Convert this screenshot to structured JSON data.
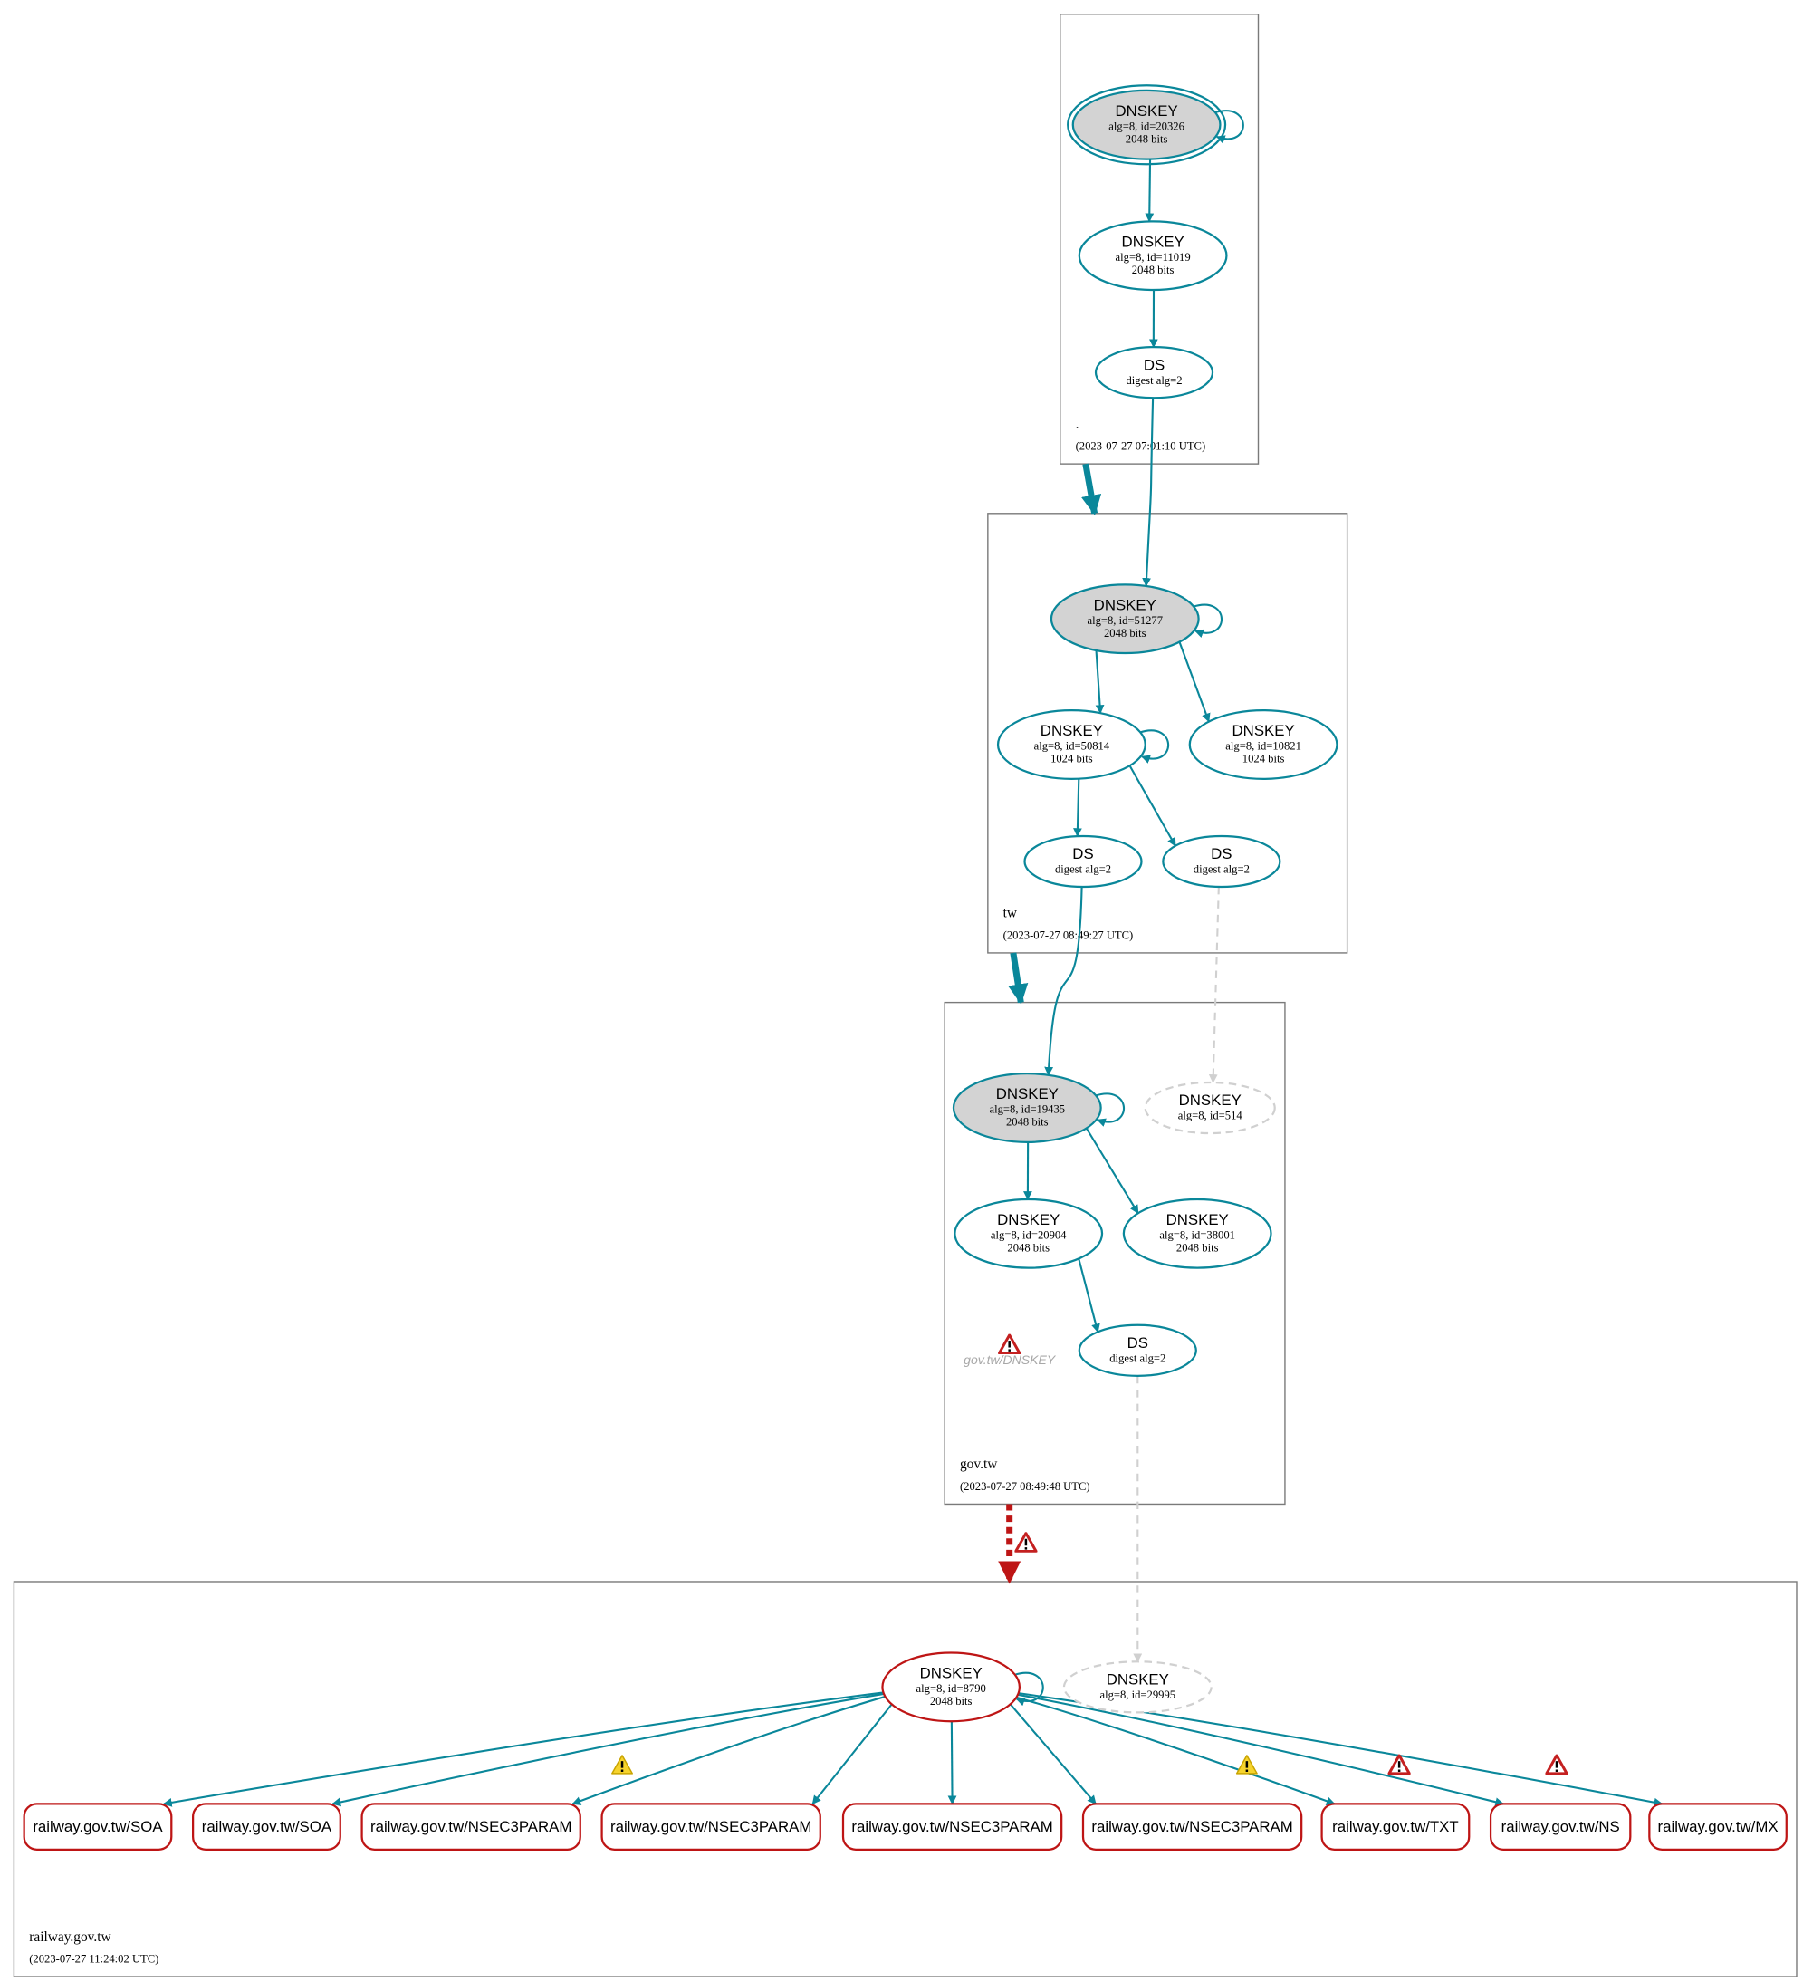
{
  "colors": {
    "secure": "#0a879a",
    "error": "#be1515",
    "dim": "#d0d0d0",
    "ksk_fill": "#d3d3d3",
    "zone_border": "#7a7a7a"
  },
  "zones": [
    {
      "id": "root",
      "name": ".",
      "timestamp": "(2023-07-27 07:01:10 UTC)"
    },
    {
      "id": "tw",
      "name": "tw",
      "timestamp": "(2023-07-27 08:49:27 UTC)"
    },
    {
      "id": "govtw",
      "name": "gov.tw",
      "timestamp": "(2023-07-27 08:49:48 UTC)"
    },
    {
      "id": "railway",
      "name": "railway.gov.tw",
      "timestamp": "(2023-07-27 11:24:02 UTC)"
    }
  ],
  "nodes": [
    {
      "id": "root_ksk",
      "zone": "root",
      "type": "DNSKEY",
      "title": "DNSKEY",
      "detail": "alg=8, id=20326",
      "bits": "2048 bits",
      "status": "secure",
      "sep": true,
      "trust_anchor": true
    },
    {
      "id": "root_zsk",
      "zone": "root",
      "type": "DNSKEY",
      "title": "DNSKEY",
      "detail": "alg=8, id=11019",
      "bits": "2048 bits",
      "status": "secure"
    },
    {
      "id": "root_ds",
      "zone": "root",
      "type": "DS",
      "title": "DS",
      "detail": "digest alg=2",
      "status": "secure"
    },
    {
      "id": "tw_ksk",
      "zone": "tw",
      "type": "DNSKEY",
      "title": "DNSKEY",
      "detail": "alg=8, id=51277",
      "bits": "2048 bits",
      "status": "secure",
      "sep": true
    },
    {
      "id": "tw_zsk1",
      "zone": "tw",
      "type": "DNSKEY",
      "title": "DNSKEY",
      "detail": "alg=8, id=50814",
      "bits": "1024 bits",
      "status": "secure"
    },
    {
      "id": "tw_zsk2",
      "zone": "tw",
      "type": "DNSKEY",
      "title": "DNSKEY",
      "detail": "alg=8, id=10821",
      "bits": "1024 bits",
      "status": "secure"
    },
    {
      "id": "tw_ds1",
      "zone": "tw",
      "type": "DS",
      "title": "DS",
      "detail": "digest alg=2",
      "status": "secure"
    },
    {
      "id": "tw_ds2",
      "zone": "tw",
      "type": "DS",
      "title": "DS",
      "detail": "digest alg=2",
      "status": "secure"
    },
    {
      "id": "gov_ksk",
      "zone": "govtw",
      "type": "DNSKEY",
      "title": "DNSKEY",
      "detail": "alg=8, id=19435",
      "bits": "2048 bits",
      "status": "secure",
      "sep": true
    },
    {
      "id": "gov_missing",
      "zone": "govtw",
      "type": "DNSKEY",
      "title": "DNSKEY",
      "detail": "alg=8, id=514",
      "status": "missing"
    },
    {
      "id": "gov_zsk1",
      "zone": "govtw",
      "type": "DNSKEY",
      "title": "DNSKEY",
      "detail": "alg=8, id=20904",
      "bits": "2048 bits",
      "status": "secure"
    },
    {
      "id": "gov_zsk2",
      "zone": "govtw",
      "type": "DNSKEY",
      "title": "DNSKEY",
      "detail": "alg=8, id=38001",
      "bits": "2048 bits",
      "status": "secure"
    },
    {
      "id": "gov_ds",
      "zone": "govtw",
      "type": "DS",
      "title": "DS",
      "detail": "digest alg=2",
      "status": "secure"
    },
    {
      "id": "rw_key",
      "zone": "railway",
      "type": "DNSKEY",
      "title": "DNSKEY",
      "detail": "alg=8, id=8790",
      "bits": "2048 bits",
      "status": "bogus"
    },
    {
      "id": "rw_missing",
      "zone": "railway",
      "type": "DNSKEY",
      "title": "DNSKEY",
      "detail": "alg=8, id=29995",
      "status": "missing"
    },
    {
      "id": "rr1",
      "zone": "railway",
      "type": "RRset",
      "title": "railway.gov.tw/SOA",
      "status": "bogus"
    },
    {
      "id": "rr2",
      "zone": "railway",
      "type": "RRset",
      "title": "railway.gov.tw/SOA",
      "status": "bogus"
    },
    {
      "id": "rr3",
      "zone": "railway",
      "type": "RRset",
      "title": "railway.gov.tw/NSEC3PARAM",
      "status": "bogus"
    },
    {
      "id": "rr4",
      "zone": "railway",
      "type": "RRset",
      "title": "railway.gov.tw/NSEC3PARAM",
      "status": "bogus"
    },
    {
      "id": "rr5",
      "zone": "railway",
      "type": "RRset",
      "title": "railway.gov.tw/NSEC3PARAM",
      "status": "bogus"
    },
    {
      "id": "rr6",
      "zone": "railway",
      "type": "RRset",
      "title": "railway.gov.tw/NSEC3PARAM",
      "status": "bogus"
    },
    {
      "id": "rr7",
      "zone": "railway",
      "type": "RRset",
      "title": "railway.gov.tw/TXT",
      "status": "bogus"
    },
    {
      "id": "rr8",
      "zone": "railway",
      "type": "RRset",
      "title": "railway.gov.tw/NS",
      "status": "bogus"
    },
    {
      "id": "rr9",
      "zone": "railway",
      "type": "RRset",
      "title": "railway.gov.tw/MX",
      "status": "bogus"
    }
  ],
  "edges": [
    {
      "from": "root_ksk",
      "to": "root_ksk",
      "status": "secure"
    },
    {
      "from": "root_ksk",
      "to": "root_zsk",
      "status": "secure"
    },
    {
      "from": "root_zsk",
      "to": "root_ds",
      "status": "secure"
    },
    {
      "from": "root_ds",
      "to": "tw_ksk",
      "status": "secure"
    },
    {
      "from": "tw_ksk",
      "to": "tw_ksk",
      "status": "secure"
    },
    {
      "from": "tw_ksk",
      "to": "tw_zsk1",
      "status": "secure"
    },
    {
      "from": "tw_ksk",
      "to": "tw_zsk2",
      "status": "secure"
    },
    {
      "from": "tw_zsk1",
      "to": "tw_zsk1",
      "status": "secure"
    },
    {
      "from": "tw_zsk1",
      "to": "tw_ds1",
      "status": "secure"
    },
    {
      "from": "tw_zsk1",
      "to": "tw_ds2",
      "status": "secure"
    },
    {
      "from": "tw_ds1",
      "to": "gov_ksk",
      "status": "secure"
    },
    {
      "from": "tw_ds2",
      "to": "gov_missing",
      "status": "missing"
    },
    {
      "from": "gov_ksk",
      "to": "gov_ksk",
      "status": "secure"
    },
    {
      "from": "gov_ksk",
      "to": "gov_zsk1",
      "status": "secure"
    },
    {
      "from": "gov_ksk",
      "to": "gov_zsk2",
      "status": "secure"
    },
    {
      "from": "gov_zsk1",
      "to": "gov_ds",
      "status": "secure"
    },
    {
      "from": "gov_ds",
      "to": "rw_missing",
      "status": "missing"
    },
    {
      "from": "rw_key",
      "to": "rw_key",
      "status": "secure"
    },
    {
      "from": "rw_key",
      "to": "rr1",
      "status": "secure"
    },
    {
      "from": "rw_key",
      "to": "rr2",
      "status": "secure"
    },
    {
      "from": "rw_key",
      "to": "rr3",
      "status": "secure",
      "warning": "warning"
    },
    {
      "from": "rw_key",
      "to": "rr4",
      "status": "secure"
    },
    {
      "from": "rw_key",
      "to": "rr5",
      "status": "secure"
    },
    {
      "from": "rw_key",
      "to": "rr6",
      "status": "secure"
    },
    {
      "from": "rw_key",
      "to": "rr7",
      "status": "secure",
      "warning": "warning"
    },
    {
      "from": "rw_key",
      "to": "rr8",
      "status": "secure",
      "warning": "error"
    },
    {
      "from": "rw_key",
      "to": "rr9",
      "status": "secure",
      "warning": "error"
    }
  ],
  "delegations": [
    {
      "from": "root",
      "to": "tw",
      "status": "secure"
    },
    {
      "from": "tw",
      "to": "govtw",
      "status": "secure"
    },
    {
      "from": "govtw",
      "to": "railway",
      "status": "bogus",
      "warning": "error"
    }
  ],
  "zone_errors": [
    {
      "zone": "govtw",
      "label": "gov.tw/DNSKEY",
      "icon": "error"
    }
  ]
}
